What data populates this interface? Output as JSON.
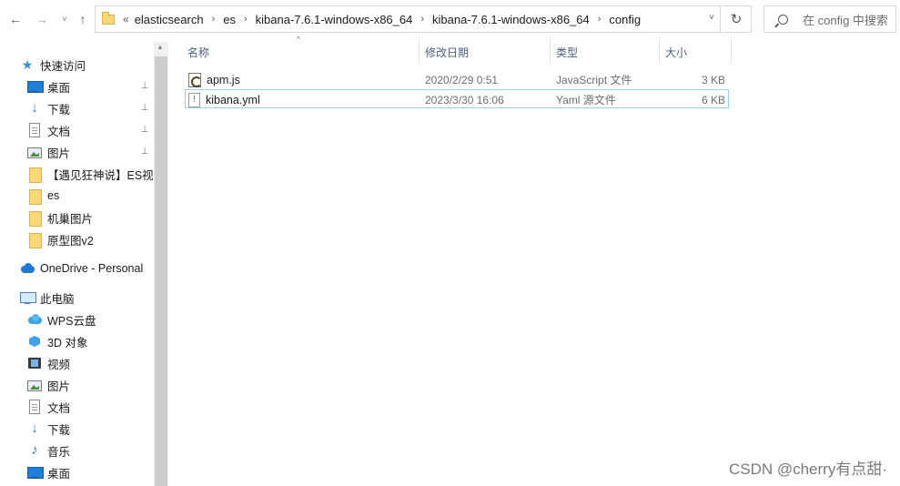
{
  "toolbar": {
    "back_icon": "←",
    "forward_icon": "→",
    "recent_icon": "˅",
    "up_icon": "↑"
  },
  "address": {
    "more": "«",
    "crumbs": [
      "elasticsearch",
      "es",
      "kibana-7.6.1-windows-x86_64",
      "kibana-7.6.1-windows-x86_64",
      "config"
    ],
    "separator": "›",
    "dropdown": "˅",
    "refresh_icon": "↻"
  },
  "search": {
    "placeholder": "在 config 中搜索"
  },
  "nav": {
    "quick_access": {
      "label": "快速访问",
      "icon": "star-icon"
    },
    "pinned": [
      {
        "label": "桌面",
        "icon": "desktop-icon"
      },
      {
        "label": "下载",
        "icon": "download-icon"
      },
      {
        "label": "文档",
        "icon": "document-icon"
      },
      {
        "label": "图片",
        "icon": "picture-icon"
      }
    ],
    "pin_glyph": "📌",
    "folders": [
      {
        "label": "【遇见狂神说】ES视频",
        "icon": "folder-icon"
      },
      {
        "label": "es",
        "icon": "folder-icon"
      },
      {
        "label": "机巢图片",
        "icon": "folder-icon"
      },
      {
        "label": "原型图v2",
        "icon": "folder-icon"
      }
    ],
    "onedrive": {
      "label": "OneDrive - Personal",
      "icon": "onedrive-cloud-icon"
    },
    "this_pc": {
      "label": "此电脑",
      "icon": "computer-icon"
    },
    "pc_items": [
      {
        "label": "WPS云盘",
        "icon": "wps-cloud-icon"
      },
      {
        "label": "3D 对象",
        "icon": "3d-objects-icon"
      },
      {
        "label": "视频",
        "icon": "video-icon"
      },
      {
        "label": "图片",
        "icon": "picture-icon"
      },
      {
        "label": "文档",
        "icon": "document-icon"
      },
      {
        "label": "下载",
        "icon": "download-icon"
      },
      {
        "label": "音乐",
        "icon": "music-icon"
      },
      {
        "label": "桌面",
        "icon": "desktop-icon"
      }
    ]
  },
  "columns": {
    "name": "名称",
    "date": "修改日期",
    "type": "类型",
    "size": "大小",
    "sort_indicator": "^"
  },
  "files": [
    {
      "name": "apm.js",
      "date": "2020/2/29 0:51",
      "type": "JavaScript 文件",
      "size": "3 KB",
      "icon": "javascript-file-icon",
      "selected": false
    },
    {
      "name": "kibana.yml",
      "date": "2023/3/30 16:06",
      "type": "Yaml 源文件",
      "size": "6 KB",
      "icon": "yaml-file-icon",
      "selected": true
    }
  ],
  "watermark": "CSDN @cherry有点甜·",
  "colors": {
    "selection_border": "#99d1ff",
    "column_header_text": "#4c607a",
    "folder_yellow": "#f8d775",
    "accent_blue": "#1f7fd8"
  }
}
